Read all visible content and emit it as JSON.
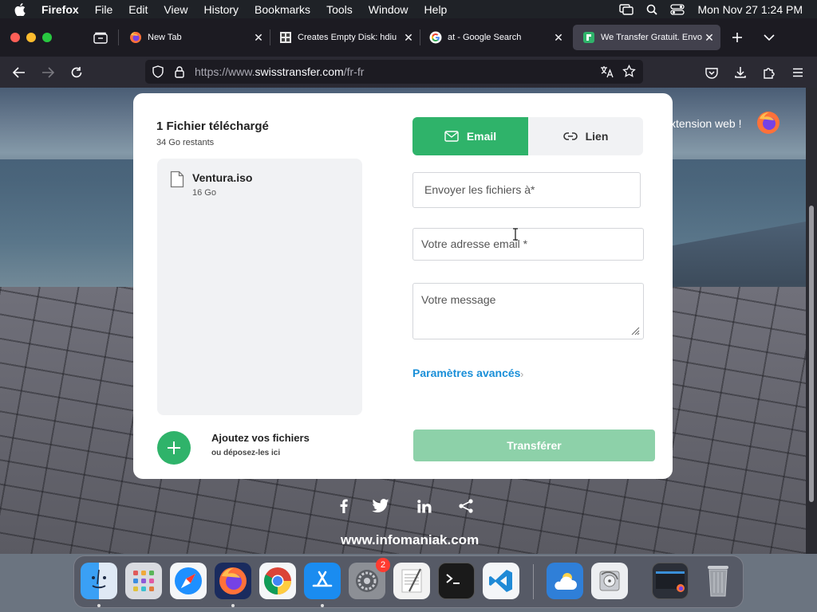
{
  "menubar": {
    "app_name": "Firefox",
    "items": [
      "File",
      "Edit",
      "View",
      "History",
      "Bookmarks",
      "Tools",
      "Window",
      "Help"
    ],
    "clock": "Mon Nov 27  1:24 PM"
  },
  "tabs": [
    {
      "title": "New Tab"
    },
    {
      "title": "Creates Empty Disk: hdiu"
    },
    {
      "title": "at - Google Search"
    },
    {
      "title": "We Transfer Gratuit. Envo"
    }
  ],
  "urlbar": {
    "prefix": "https://www.",
    "domain": "swisstransfer.com",
    "path": "/fr-fr"
  },
  "upload": {
    "title": "1 Fichier téléchargé",
    "remaining": "34 Go restants",
    "files": [
      {
        "name": "Ventura.iso",
        "size": "16 Go"
      }
    ],
    "add_title": "Ajoutez vos fichiers",
    "add_subtitle": "ou déposez-les ici"
  },
  "form": {
    "tab_email": "Email",
    "tab_link": "Lien",
    "dest_placeholder": "Envoyer les fichiers à*",
    "from_placeholder": "Votre adresse email *",
    "message_placeholder": "Votre message",
    "advanced": "Paramètres avancés",
    "submit": "Transférer"
  },
  "extension_text": "xtension web !",
  "footer": {
    "site": "www.infomaniak.com"
  },
  "dock": {
    "settings_badge": "2"
  },
  "colors": {
    "accent_green": "#2fb36a",
    "disabled_green": "#8dd1a9",
    "link_blue": "#1a8fd8"
  }
}
